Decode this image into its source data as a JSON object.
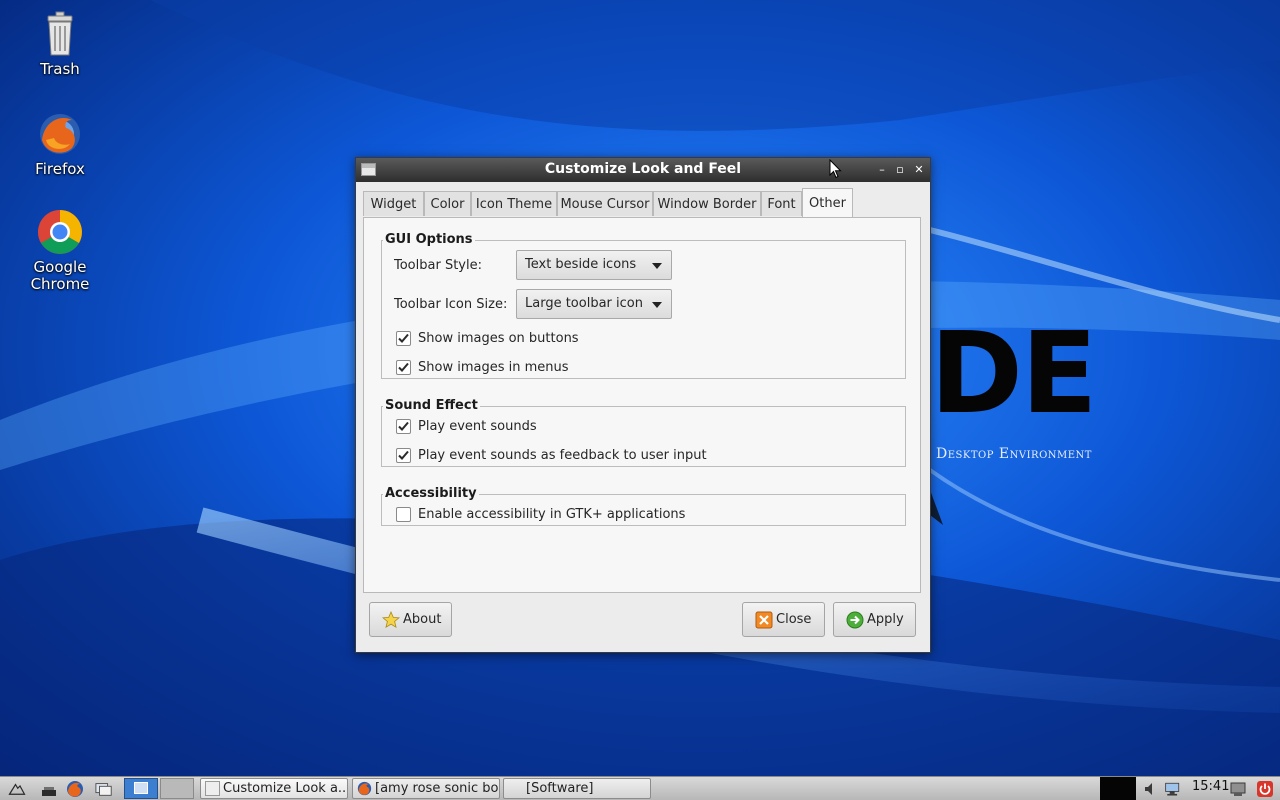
{
  "desktop": {
    "icons": [
      {
        "label_line1": "Trash",
        "label_line2": ""
      },
      {
        "label_line1": "Firefox",
        "label_line2": ""
      },
      {
        "label_line1": "Google",
        "label_line2": "Chrome"
      }
    ],
    "brand_logo": "DE",
    "brand_tagline": "Desktop Environment"
  },
  "window": {
    "title": "Customize Look and Feel",
    "tabs": [
      "Widget",
      "Color",
      "Icon Theme",
      "Mouse Cursor",
      "Window Border",
      "Font",
      "Other"
    ],
    "active_tab": "Other",
    "gui_options": {
      "title": "GUI Options",
      "toolbar_style_label": "Toolbar Style:",
      "toolbar_style_value": "Text beside icons",
      "toolbar_icon_size_label": "Toolbar Icon Size:",
      "toolbar_icon_size_value": "Large toolbar icon",
      "show_images_buttons": {
        "label": "Show images on buttons",
        "checked": true
      },
      "show_images_menus": {
        "label": "Show images in menus",
        "checked": true
      }
    },
    "sound_effect": {
      "title": "Sound Effect",
      "play_event_sounds": {
        "label": "Play event sounds",
        "checked": true
      },
      "play_feedback": {
        "label": "Play event sounds as feedback to user input",
        "checked": true
      }
    },
    "accessibility": {
      "title": "Accessibility",
      "enable_gtk": {
        "label": "Enable accessibility in GTK+ applications",
        "checked": false
      }
    },
    "buttons": {
      "about": "About",
      "close": "Close",
      "apply": "Apply"
    }
  },
  "taskbar": {
    "tasks": [
      "Customize Look a...",
      "[amy rose sonic bo...",
      "[Software]"
    ],
    "clock": "15:41"
  },
  "colors": {
    "accent_check": "#2b2b2b",
    "titlebar": "#3a3a3a",
    "desktop_blue": "#0b4bbf"
  }
}
